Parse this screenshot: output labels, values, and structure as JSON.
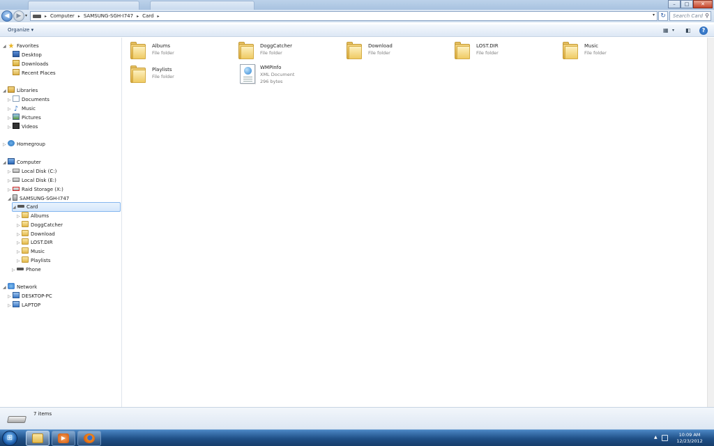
{
  "window": {
    "controls": {
      "minimize": "–",
      "maximize": "□",
      "close": "✕"
    }
  },
  "address_bar": {
    "breadcrumbs": [
      "Computer",
      "SAMSUNG-SGH-I747",
      "Card"
    ],
    "search_placeholder": "Search Card"
  },
  "command_bar": {
    "organize_label": "Organize ▾"
  },
  "nav_pane": {
    "favorites": {
      "label": "Favorites",
      "items": [
        "Desktop",
        "Downloads",
        "Recent Places"
      ]
    },
    "libraries": {
      "label": "Libraries",
      "items": [
        "Documents",
        "Music",
        "Pictures",
        "Videos"
      ]
    },
    "homegroup": {
      "label": "Homegroup"
    },
    "computer": {
      "label": "Computer",
      "drives": [
        "Local Disk (C:)",
        "Local Disk (E:)",
        "Raid Storage (X:)"
      ],
      "device": "SAMSUNG-SGH-I747",
      "card": "Card",
      "card_folders": [
        "Albums",
        "DoggCatcher",
        "Download",
        "LOST.DIR",
        "Music",
        "Playlists"
      ],
      "phone": "Phone"
    },
    "network": {
      "label": "Network",
      "items": [
        "DESKTOP-PC",
        "LAPTOP"
      ]
    }
  },
  "content": {
    "items": [
      {
        "name": "Albums",
        "type": "File folder"
      },
      {
        "name": "DoggCatcher",
        "type": "File folder"
      },
      {
        "name": "Download",
        "type": "File folder"
      },
      {
        "name": "LOST.DIR",
        "type": "File folder"
      },
      {
        "name": "Music",
        "type": "File folder"
      },
      {
        "name": "Playlists",
        "type": "File folder"
      },
      {
        "name": "WMPInfo",
        "type": "XML Document",
        "size": "296 bytes"
      }
    ]
  },
  "details_pane": {
    "item_count": "7 items"
  },
  "taskbar": {
    "start_icon": "windows-logo",
    "apps": [
      "windows-explorer",
      "windows-media-player",
      "firefox"
    ],
    "clock_time": "10:09 AM",
    "clock_date": "12/23/2012"
  }
}
